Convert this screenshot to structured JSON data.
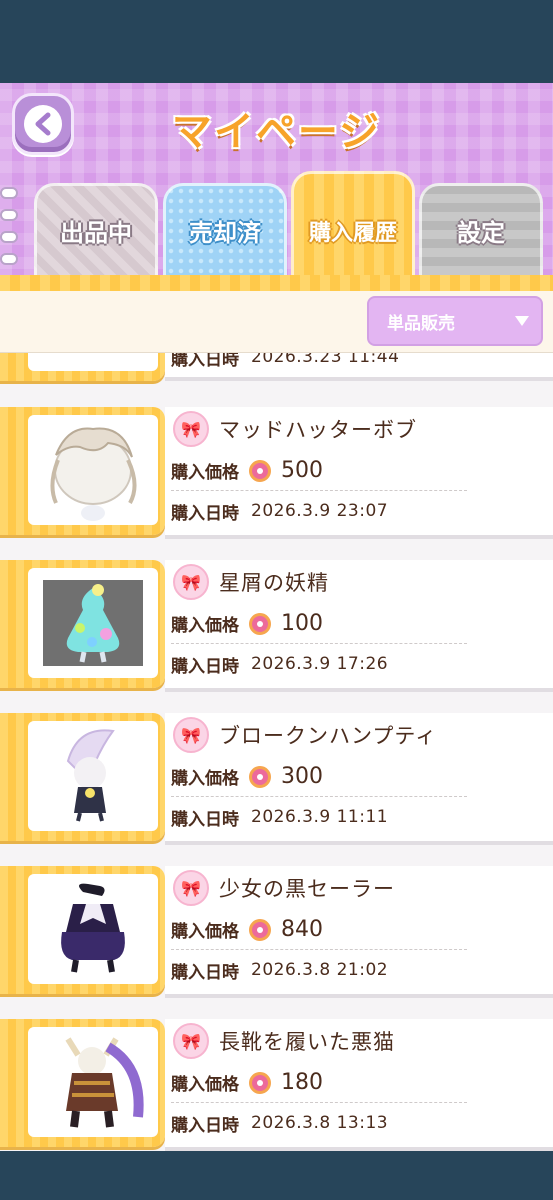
{
  "header": {
    "title": "マイページ",
    "back_label": "‹"
  },
  "tabs": [
    {
      "label": "出品中"
    },
    {
      "label": "売却済"
    },
    {
      "label": "購入履歴"
    },
    {
      "label": "設定"
    }
  ],
  "filter": {
    "selected": "単品販売"
  },
  "labels": {
    "price": "購入価格",
    "date": "購入日時"
  },
  "partial_item": {
    "date_label": "購入日時",
    "date": "2026.3.23 11:44"
  },
  "items": [
    {
      "name": "マッドハッターボブ",
      "price": "500",
      "date": "2026.3.9 23:07"
    },
    {
      "name": "星屑の妖精",
      "price": "100",
      "date": "2026.3.9 17:26"
    },
    {
      "name": "ブロークンハンプティ",
      "price": "300",
      "date": "2026.3.9 11:11"
    },
    {
      "name": "少女の黒セーラー",
      "price": "840",
      "date": "2026.3.8 21:02"
    },
    {
      "name": "長靴を履いた悪猫",
      "price": "180",
      "date": "2026.3.8 13:13"
    }
  ],
  "colors": {
    "header_bg": "#d79ce9",
    "active_tab": "#ffd66a",
    "text_brown": "#4b2c1d",
    "accent_pink": "#e23a7a"
  }
}
